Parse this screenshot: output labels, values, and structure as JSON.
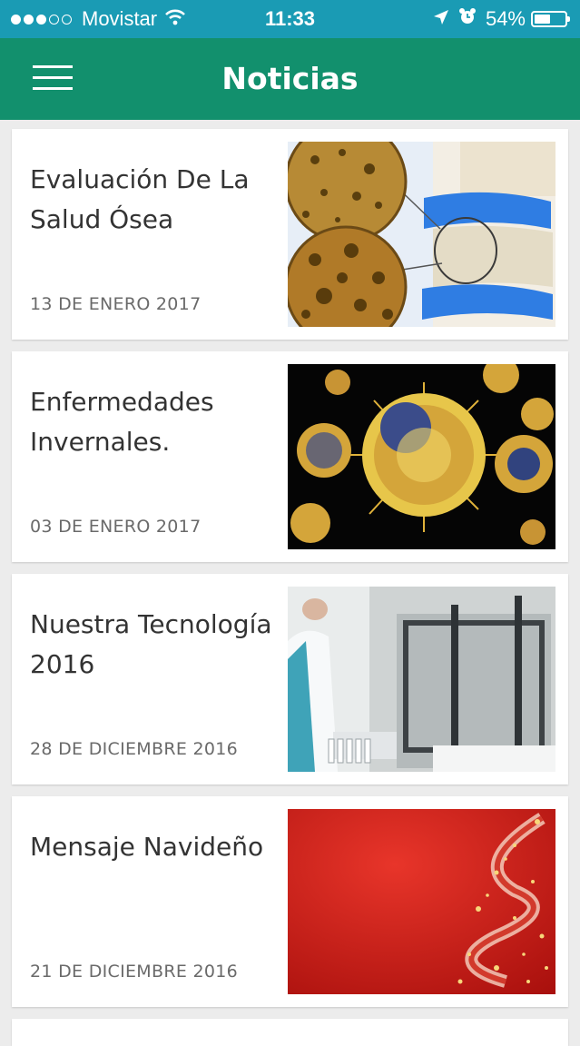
{
  "status_bar": {
    "carrier": "Movistar",
    "time": "11:33",
    "battery_percent": "54%",
    "signal_bars_filled": 3,
    "signal_bars_total": 5,
    "battery_level": 0.54,
    "icons": [
      "signal-dots-icon",
      "wifi-icon",
      "location-arrow-icon",
      "alarm-clock-icon",
      "battery-icon"
    ]
  },
  "app_bar": {
    "title": "Noticias",
    "menu_icon": "hamburger-menu-icon",
    "background": "#12906d"
  },
  "news": [
    {
      "title": "Evaluación De La Salud Ósea",
      "date": "13 DE ENERO 2017",
      "image": "bone-spine-illustration"
    },
    {
      "title": "Enfermedades Invernales.",
      "date": "03 DE ENERO 2017",
      "image": "virus-illustration"
    },
    {
      "title": "Nuestra Tecnología 2016",
      "date": "28 DE DICIEMBRE 2016",
      "image": "lab-technician-photo"
    },
    {
      "title": "Mensaje Navideño",
      "date": "21 DE DICIEMBRE 2016",
      "image": "christmas-tree-ribbon"
    }
  ],
  "colors": {
    "status_bar": "#1a9bb4",
    "app_bar": "#12906d",
    "background": "#ececec"
  }
}
